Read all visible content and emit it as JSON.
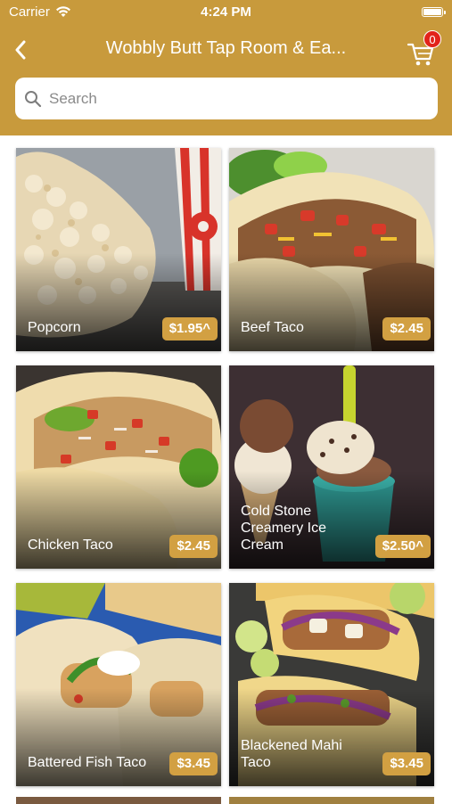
{
  "status_bar": {
    "carrier": "Carrier",
    "time": "4:24 PM"
  },
  "navbar": {
    "title": "Wobbly Butt Tap Room & Ea...",
    "cart_count": "0"
  },
  "search": {
    "placeholder": "Search"
  },
  "colors": {
    "header": "#c89a3c",
    "price_badge": "#d2a042",
    "cart_badge": "#e2231a"
  },
  "menu_items": [
    {
      "name": "Popcorn",
      "price": "$1.95^"
    },
    {
      "name": "Beef Taco",
      "price": "$2.45"
    },
    {
      "name": "Chicken Taco",
      "price": "$2.45"
    },
    {
      "name": "Cold Stone Creamery Ice Cream",
      "price": "$2.50^"
    },
    {
      "name": "Battered Fish Taco",
      "price": "$3.45"
    },
    {
      "name": "Blackened Mahi Taco",
      "price": "$3.45"
    }
  ]
}
